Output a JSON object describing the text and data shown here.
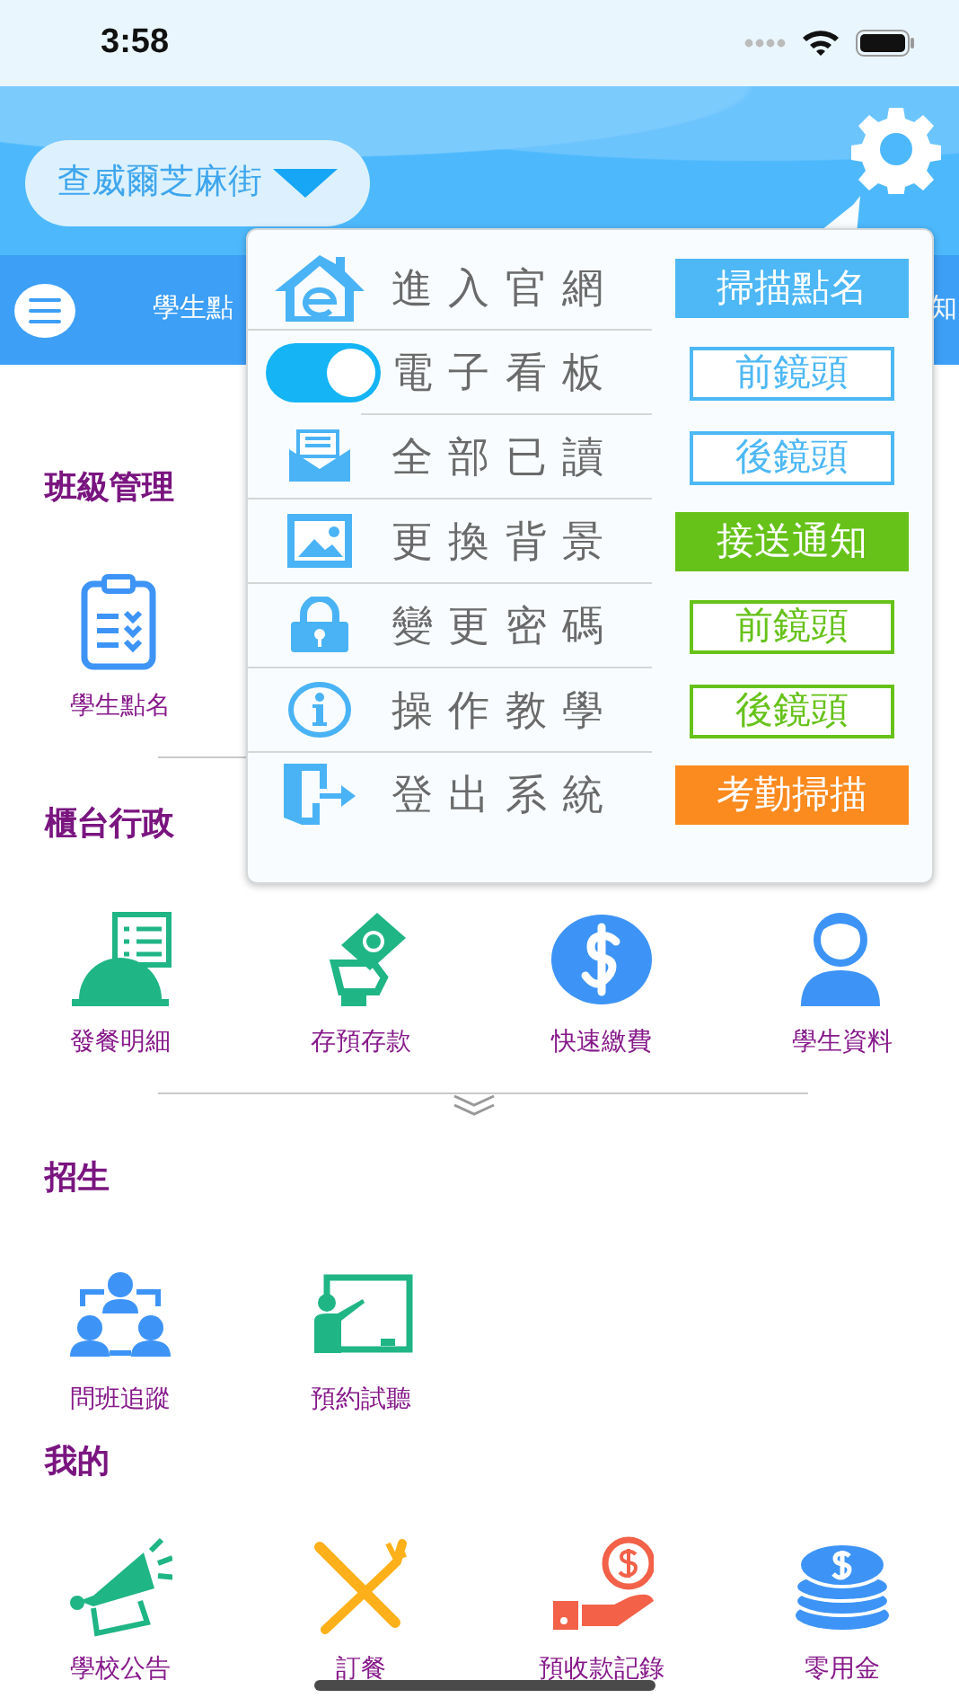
{
  "status_bar": {
    "time": "3:58"
  },
  "header": {
    "location": "查威爾芝麻街"
  },
  "nav": {
    "items": [
      "學生點",
      "知"
    ]
  },
  "popup_menu": {
    "items": [
      {
        "label": "進入官網",
        "kind": "icon",
        "button": {
          "label": "掃描點名",
          "kind": "filled",
          "color": "#4db8f5"
        }
      },
      {
        "label": "電子看板",
        "kind": "toggle",
        "on": true,
        "button": {
          "label": "前鏡頭",
          "kind": "outline",
          "color": "#4db8f5"
        }
      },
      {
        "label": "全部已讀",
        "kind": "icon",
        "button": {
          "label": "後鏡頭",
          "kind": "outline",
          "color": "#4db8f5"
        }
      },
      {
        "label": "更換背景",
        "kind": "icon",
        "button": {
          "label": "接送通知",
          "kind": "filled",
          "color": "#66c219"
        }
      },
      {
        "label": "變更密碼",
        "kind": "icon",
        "button": {
          "label": "前鏡頭",
          "kind": "outline",
          "color": "#66c219"
        }
      },
      {
        "label": "操作教學",
        "kind": "icon",
        "button": {
          "label": "後鏡頭",
          "kind": "outline",
          "color": "#66c219"
        }
      },
      {
        "label": "登出系統",
        "kind": "icon",
        "button": {
          "label": "考勤掃描",
          "kind": "filled",
          "color": "#fb8a1f"
        }
      }
    ]
  },
  "sections": [
    {
      "title": "班級管理",
      "items": [
        {
          "label": "學生點名"
        }
      ]
    },
    {
      "title": "櫃台行政",
      "items": [
        {
          "label": "發餐明細"
        },
        {
          "label": "存預存款"
        },
        {
          "label": "快速繳費"
        },
        {
          "label": "學生資料"
        }
      ]
    },
    {
      "title": "招生",
      "items": [
        {
          "label": "問班追蹤"
        },
        {
          "label": "預約試聽"
        }
      ]
    },
    {
      "title": "我的",
      "items": [
        {
          "label": "學校公告"
        },
        {
          "label": "訂餐"
        },
        {
          "label": "預收款記錄"
        },
        {
          "label": "零用金"
        }
      ]
    }
  ]
}
